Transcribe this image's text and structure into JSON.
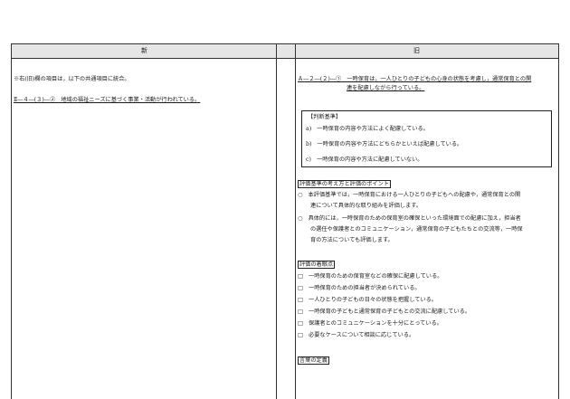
{
  "table": {
    "header_new": "新",
    "header_old": "旧"
  },
  "left": {
    "note": "※右(旧)欄の項目は，以下の共通項目に統合。",
    "item": "Ⅱ―４―(３)―②　地域の福祉ニーズに基づく事業・活動が行われている。"
  },
  "right": {
    "title_line1": "Ａ―２―(２)―①　一時保育は，一人ひとりの子どもの心身の状態を考慮し，通常保育との関",
    "title_line2": "連を配慮しながら行っている。",
    "criteria": {
      "heading": "【判断基準】",
      "a": "a)　一時保育の内容や方法によく配慮している。",
      "b": "b)　一時保育の内容や方法にどちらかといえば配慮している。",
      "c": "c)　一時保育の内容や方法に配慮していない。"
    },
    "points": {
      "heading": "評価基準の考え方と評価のポイント",
      "p1_line1": "○　本評価基準では，一時保育における一人ひとりの子どもへの配慮や，通常保育との関",
      "p1_line2": "連について具体的な取り組みを評価します。",
      "p2_line1": "○　具体的には，一時保育のための保育室の確保といった環境面での配慮に加え，担当者",
      "p2_line2": "の選任や保護者とのコミュニケーション，通常保育の子どもたちとの交流等，一時保",
      "p2_line3": "育の方法についても評価します。"
    },
    "checks": {
      "heading": "評価の着眼点",
      "c1": "□　一時保育のための保育室などの確保に配慮している。",
      "c2": "□　一時保育のための担当者が決められている。",
      "c3": "□　一人ひとりの子どもの日々の状態を把握している。",
      "c4": "□　一時保育の子どもと通常保育の子どもとの交流に配慮している。",
      "c5": "□　保護者とのコミュニケーションを十分にとっている。",
      "c6": "□　必要なケースについて相談に応じている。"
    },
    "terms_heading": "言葉の定義"
  }
}
